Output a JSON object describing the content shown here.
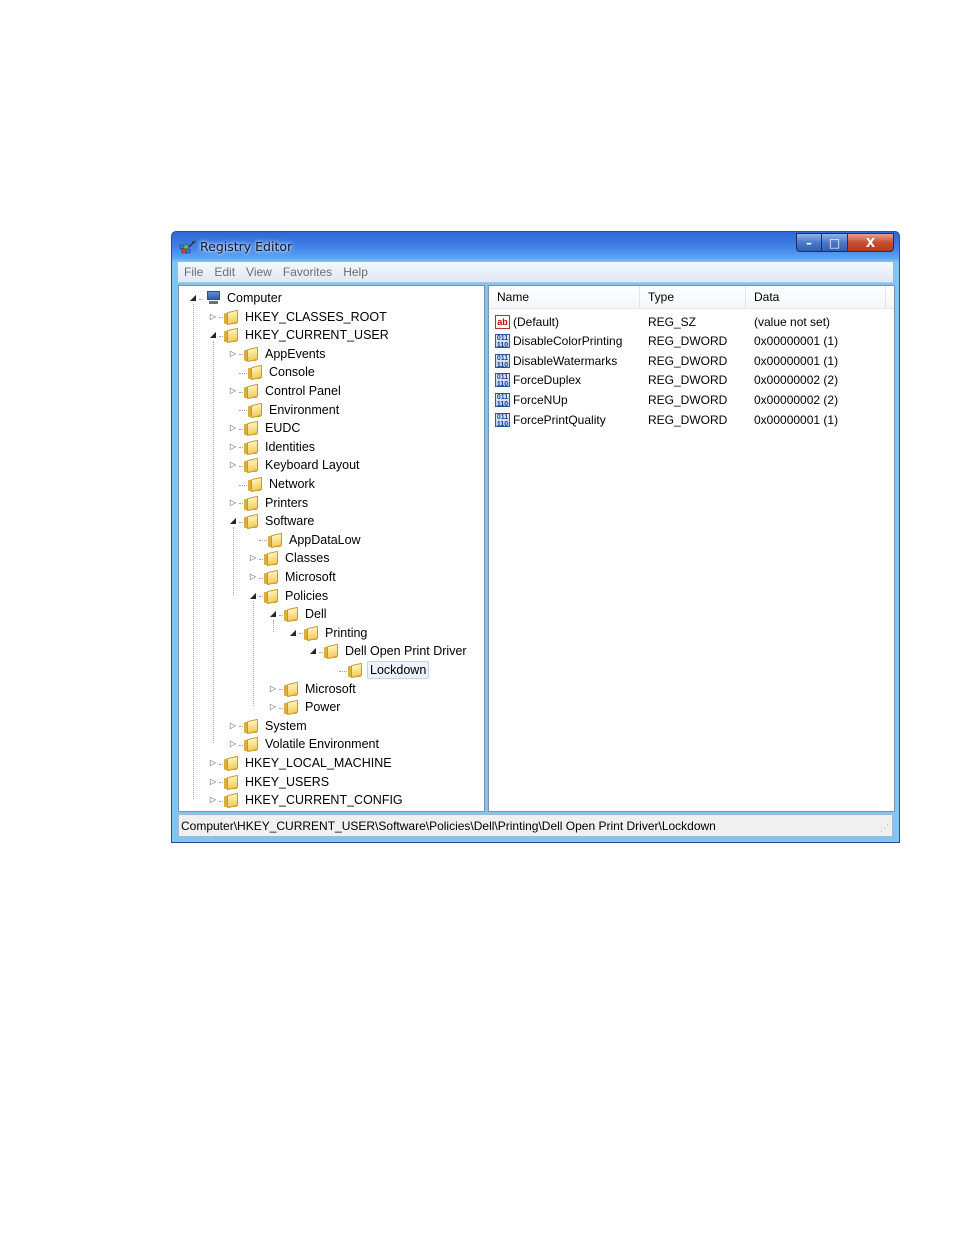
{
  "window": {
    "title": "Registry Editor",
    "buttons": {
      "minimize": "–",
      "maximize": "□",
      "close": "X"
    }
  },
  "menu": [
    "File",
    "Edit",
    "View",
    "Favorites",
    "Help"
  ],
  "tree": [
    {
      "label": "Computer",
      "depth": 0,
      "toggle": "open",
      "icon": "computer"
    },
    {
      "label": "HKEY_CLASSES_ROOT",
      "depth": 1,
      "toggle": "closed"
    },
    {
      "label": "HKEY_CURRENT_USER",
      "depth": 1,
      "toggle": "open"
    },
    {
      "label": "AppEvents",
      "depth": 2,
      "toggle": "closed"
    },
    {
      "label": "Console",
      "depth": 2,
      "toggle": "none"
    },
    {
      "label": "Control Panel",
      "depth": 2,
      "toggle": "closed"
    },
    {
      "label": "Environment",
      "depth": 2,
      "toggle": "none"
    },
    {
      "label": "EUDC",
      "depth": 2,
      "toggle": "closed"
    },
    {
      "label": "Identities",
      "depth": 2,
      "toggle": "closed"
    },
    {
      "label": "Keyboard Layout",
      "depth": 2,
      "toggle": "closed"
    },
    {
      "label": "Network",
      "depth": 2,
      "toggle": "none"
    },
    {
      "label": "Printers",
      "depth": 2,
      "toggle": "closed"
    },
    {
      "label": "Software",
      "depth": 2,
      "toggle": "open"
    },
    {
      "label": "AppDataLow",
      "depth": 3,
      "toggle": "none"
    },
    {
      "label": "Classes",
      "depth": 3,
      "toggle": "closed"
    },
    {
      "label": "Microsoft",
      "depth": 3,
      "toggle": "closed"
    },
    {
      "label": "Policies",
      "depth": 3,
      "toggle": "open"
    },
    {
      "label": "Dell",
      "depth": 4,
      "toggle": "open"
    },
    {
      "label": "Printing",
      "depth": 5,
      "toggle": "open"
    },
    {
      "label": "Dell Open Print Driver",
      "depth": 6,
      "toggle": "open"
    },
    {
      "label": "Lockdown",
      "depth": 7,
      "toggle": "none",
      "selected": true
    },
    {
      "label": "Microsoft",
      "depth": 4,
      "toggle": "closed"
    },
    {
      "label": "Power",
      "depth": 4,
      "toggle": "closed"
    },
    {
      "label": "System",
      "depth": 2,
      "toggle": "closed"
    },
    {
      "label": "Volatile Environment",
      "depth": 2,
      "toggle": "closed"
    },
    {
      "label": "HKEY_LOCAL_MACHINE",
      "depth": 1,
      "toggle": "closed"
    },
    {
      "label": "HKEY_USERS",
      "depth": 1,
      "toggle": "closed"
    },
    {
      "label": "HKEY_CURRENT_CONFIG",
      "depth": 1,
      "toggle": "closed"
    }
  ],
  "list": {
    "columns": [
      "Name",
      "Type",
      "Data"
    ],
    "rows": [
      {
        "icon": "string",
        "name": "(Default)",
        "type": "REG_SZ",
        "data": "(value not set)"
      },
      {
        "icon": "dword",
        "name": "DisableColorPrinting",
        "type": "REG_DWORD",
        "data": "0x00000001 (1)"
      },
      {
        "icon": "dword",
        "name": "DisableWatermarks",
        "type": "REG_DWORD",
        "data": "0x00000001 (1)"
      },
      {
        "icon": "dword",
        "name": "ForceDuplex",
        "type": "REG_DWORD",
        "data": "0x00000002 (2)"
      },
      {
        "icon": "dword",
        "name": "ForceNUp",
        "type": "REG_DWORD",
        "data": "0x00000002 (2)"
      },
      {
        "icon": "dword",
        "name": "ForcePrintQuality",
        "type": "REG_DWORD",
        "data": "0x00000001 (1)"
      }
    ]
  },
  "status": "Computer\\HKEY_CURRENT_USER\\Software\\Policies\\Dell\\Printing\\Dell Open Print Driver\\Lockdown"
}
